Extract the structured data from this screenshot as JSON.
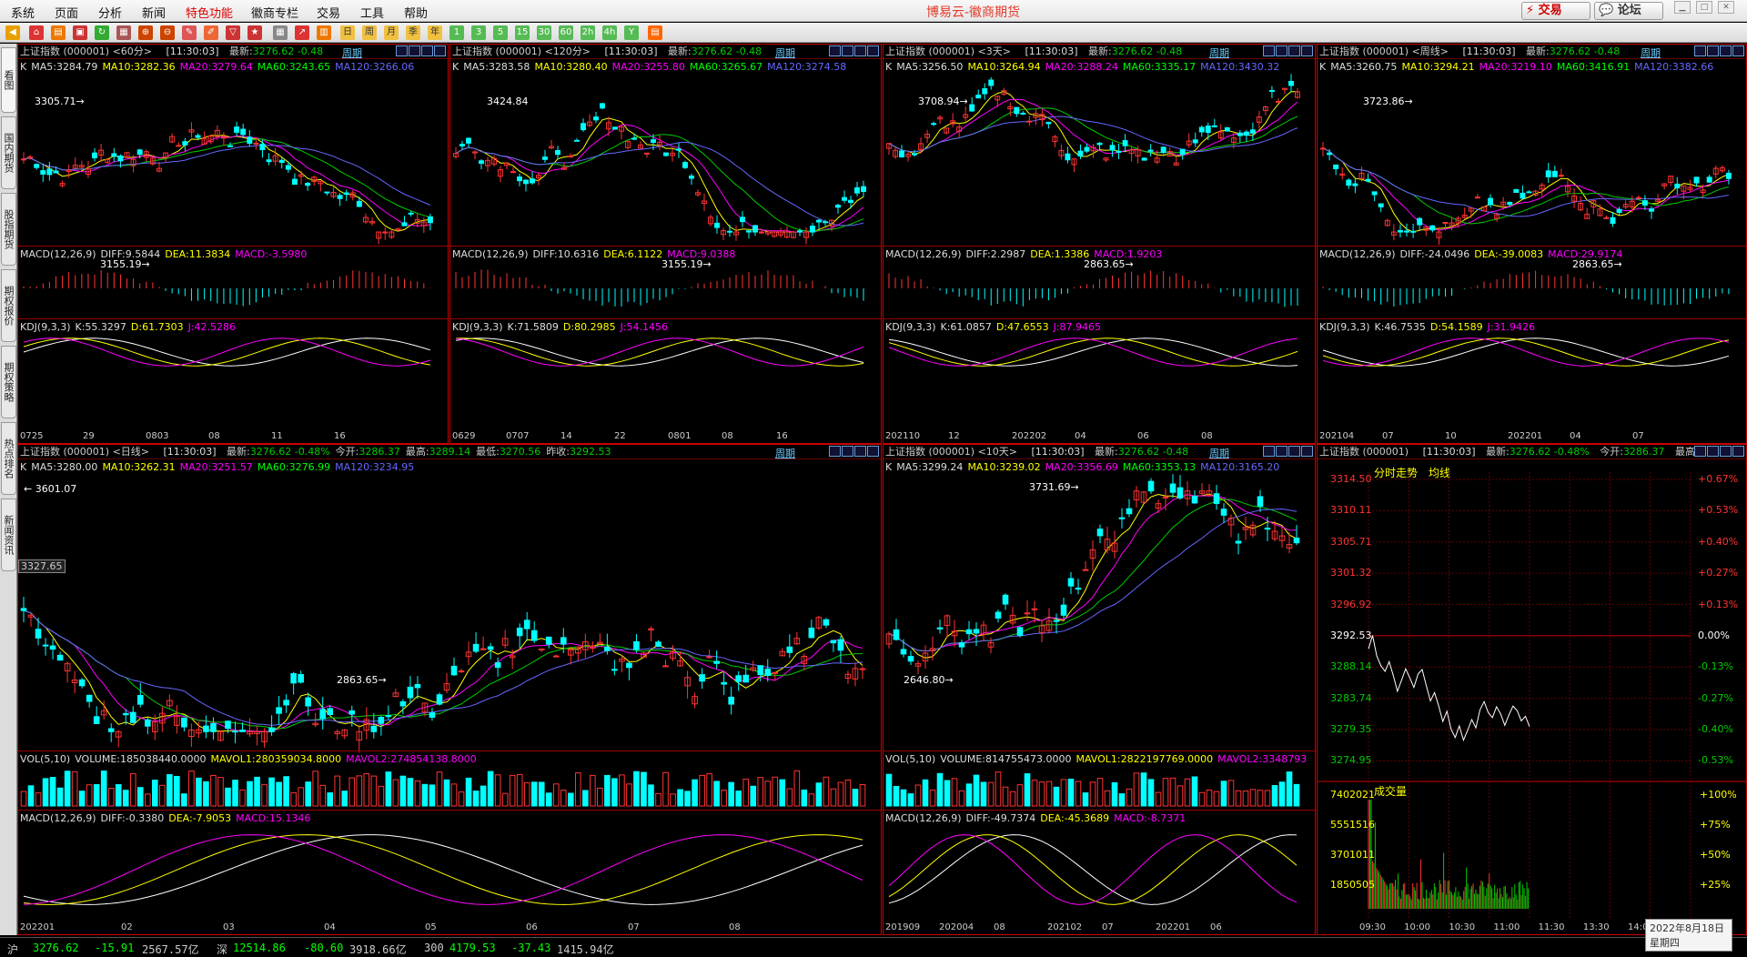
{
  "menu": {
    "items": [
      "系统",
      "页面",
      "分析",
      "新闻",
      "特色功能",
      "徽商专栏",
      "交易",
      "工具",
      "帮助"
    ],
    "highlight": "特色功能"
  },
  "app_title": "博易云-徽商期货",
  "top_buttons": {
    "trade": "⚡ 交易",
    "forum": "💬 论坛"
  },
  "left_tabs": [
    "看图",
    "国内期货",
    "股指期货",
    "期权报价",
    "期权策略",
    "热点排名",
    "新闻资讯"
  ],
  "toolbar_period_buttons": [
    "日",
    "周",
    "月",
    "季",
    "年",
    "1",
    "3",
    "5",
    "15",
    "30",
    "60",
    "2h",
    "4h",
    "Y"
  ],
  "panels": [
    {
      "title": "上证指数 (000001) <60分>",
      "time": "[11:30:03]",
      "latest_label": "最新:",
      "latest": "3276.62",
      "chg": "-0.48",
      "link": "周期",
      "ma": [
        "K",
        "MA5:3284.79",
        "MA10:3282.36",
        "MA20:3279.64",
        "MA60:3243.65",
        "MA120:3266.06"
      ],
      "high_annot": "3305.71→",
      "low_annot": "3155.19→",
      "ind1": [
        "MACD(12,26,9)",
        "DIFF:9.5844",
        "DEA:11.3834",
        "MACD:-3.5980"
      ],
      "ind2": [
        "KDJ(9,3,3)",
        "K:55.3297",
        "D:61.7303",
        "J:42.5286"
      ],
      "xticks": [
        "0725",
        "29",
        "0803",
        "08",
        "11",
        "16"
      ]
    },
    {
      "title": "上证指数 (000001) <120分>",
      "time": "[11:30:03]",
      "latest_label": "最新:",
      "latest": "3276.62",
      "chg": "-0.48",
      "link": "周期",
      "ma": [
        "K",
        "MA5:3283.58",
        "MA10:3280.40",
        "MA20:3255.80",
        "MA60:3265.67",
        "MA120:3274.58"
      ],
      "high_annot": "3424.84",
      "low_annot": "3155.19→",
      "ind1": [
        "MACD(12,26,9)",
        "DIFF:10.6316",
        "DEA:6.1122",
        "MACD:9.0388"
      ],
      "ind2": [
        "KDJ(9,3,3)",
        "K:71.5809",
        "D:80.2985",
        "J:54.1456"
      ],
      "xticks": [
        "0629",
        "0707",
        "14",
        "22",
        "0801",
        "08",
        "16"
      ]
    },
    {
      "title": "上证指数 (000001) <3天>",
      "time": "[11:30:03]",
      "latest_label": "最新:",
      "latest": "3276.62",
      "chg": "-0.48",
      "link": "周期",
      "ma": [
        "K",
        "MA5:3256.50",
        "MA10:3264.94",
        "MA20:3288.24",
        "MA60:3335.17",
        "MA120:3430.32"
      ],
      "high_annot": "3708.94→",
      "low_annot": "2863.65→",
      "ind1": [
        "MACD(12,26,9)",
        "DIFF:2.2987",
        "DEA:1.3386",
        "MACD:1.9203"
      ],
      "ind2": [
        "KDJ(9,3,3)",
        "K:61.0857",
        "D:47.6553",
        "J:87.9465"
      ],
      "xticks": [
        "202110",
        "12",
        "202202",
        "04",
        "06",
        "08"
      ]
    },
    {
      "title": "上证指数 (000001) <周线>",
      "time": "[11:30:03]",
      "latest_label": "最新:",
      "latest": "3276.62",
      "chg": "-0.48",
      "link": "周期",
      "ma": [
        "K",
        "MA5:3260.75",
        "MA10:3294.21",
        "MA20:3219.10",
        "MA60:3416.91",
        "MA120:3382.66"
      ],
      "high_annot": "3723.86→",
      "low_annot": "2863.65→",
      "ind1": [
        "MACD(12,26,9)",
        "DIFF:-24.0496",
        "DEA:-39.0083",
        "MACD:29.9174"
      ],
      "ind2": [
        "KDJ(9,3,3)",
        "K:46.7535",
        "D:54.1589",
        "J:31.9426"
      ],
      "xticks": [
        "202104",
        "07",
        "10",
        "202201",
        "04",
        "07"
      ]
    },
    {
      "title": "上证指数 (000001) <日线>",
      "time": "[11:30:03]",
      "latest_label": "最新:",
      "latest": "3276.62",
      "chg": "-0.48%",
      "extra": [
        "今开:",
        "3286.37",
        "最高:",
        "3289.14",
        "最低:",
        "3270.56",
        "昨收:",
        "3292.53"
      ],
      "link": "周期",
      "ma": [
        "K",
        "MA5:3280.00",
        "MA10:3262.31",
        "MA20:3251.57",
        "MA60:3276.99",
        "MA120:3234.95"
      ],
      "high_annot": "← 3601.07",
      "low_annot": "2863.65→",
      "cursor_label": "3327.65",
      "ind1": [
        "VOL(5,10)",
        "VOLUME:185038440.0000",
        "MAVOL1:280359034.8000",
        "MAVOL2:274854138.8000"
      ],
      "ind2": [
        "MACD(12,26,9)",
        "DIFF:-0.3380",
        "DEA:-7.9053",
        "MACD:15.1346"
      ],
      "xticks": [
        "202201",
        "02",
        "03",
        "04",
        "05",
        "06",
        "07",
        "08"
      ]
    },
    {
      "title": "上证指数 (000001) <10天>",
      "time": "[11:30:03]",
      "latest_label": "最新:",
      "latest": "3276.62",
      "chg": "-0.48",
      "link": "周期",
      "ma": [
        "K",
        "MA5:3299.24",
        "MA10:3239.02",
        "MA20:3356.69",
        "MA60:3353.13",
        "MA120:3165.20"
      ],
      "high_annot": "3731.69→",
      "low_annot": "2646.80→",
      "ind1": [
        "VOL(5,10)",
        "VOLUME:814755473.0000",
        "MAVOL1:2822197769.0000",
        "MAVOL2:3348793"
      ],
      "ind2": [
        "MACD(12,26,9)",
        "DIFF:-49.7374",
        "DEA:-45.3689",
        "MACD:-8.7371"
      ],
      "xticks": [
        "201909",
        "202004",
        "08",
        "202102",
        "07",
        "202201",
        "06"
      ]
    }
  ],
  "intraday": {
    "title": "上证指数 (000001)",
    "time": "[11:30:03]",
    "latest_label": "最新:",
    "latest": "3276.62",
    "chg": "-0.48%",
    "open_label": "今开:",
    "open": "3286.37",
    "high_label": "最高",
    "tab1": "分时走势",
    "tab2": "均线",
    "prices": [
      "3314.50",
      "3310.11",
      "3305.71",
      "3301.32",
      "3296.92",
      "3292.53",
      "3288.14",
      "3283.74",
      "3279.35",
      "3274.95"
    ],
    "pcts": [
      "+0.67%",
      "+0.53%",
      "+0.40%",
      "+0.27%",
      "+0.13%",
      "0.00%",
      "-0.13%",
      "-0.27%",
      "-0.40%",
      "-0.53%"
    ],
    "vol_label": "成交量",
    "vols": [
      "7402021",
      "5551516",
      "3701011",
      "1850505"
    ],
    "vol_pcts": [
      "+100%",
      "+75%",
      "+50%",
      "+25%"
    ],
    "xticks": [
      "09:30",
      "10:00",
      "10:30",
      "11:00",
      "11:30",
      "13:30",
      "14:00",
      "14"
    ],
    "price_series": [
      3288.1,
      3290.2,
      3287.0,
      3285.5,
      3284.6,
      3286.1,
      3284.0,
      3281.5,
      3283.2,
      3285.0,
      3283.6,
      3282.1,
      3284.2,
      3284.9,
      3282.4,
      3280.0,
      3281.3,
      3279.2,
      3276.8,
      3278.4,
      3275.6,
      3274.3,
      3276.1,
      3273.9,
      3275.4,
      3277.1,
      3275.8,
      3278.6,
      3279.9,
      3278.2,
      3277.4,
      3279.1,
      3278.0,
      3276.2,
      3277.8,
      3279.2,
      3278.5,
      3276.9,
      3277.6,
      3276.0
    ]
  },
  "status": {
    "sh_label": "沪",
    "sh": "3276.62",
    "sh_chg": "-15.91",
    "sh_amt": "2567.57亿",
    "sz_label": "深",
    "sz": "12514.86",
    "sz_chg": "-80.60",
    "sz_amt": "3918.66亿",
    "c300_label": "300",
    "c300": "4179.53",
    "c300_chg": "-37.43",
    "c300_amt": "1415.94亿"
  },
  "datebox": {
    "date": "2022年8月18日",
    "weekday": "星期四"
  }
}
